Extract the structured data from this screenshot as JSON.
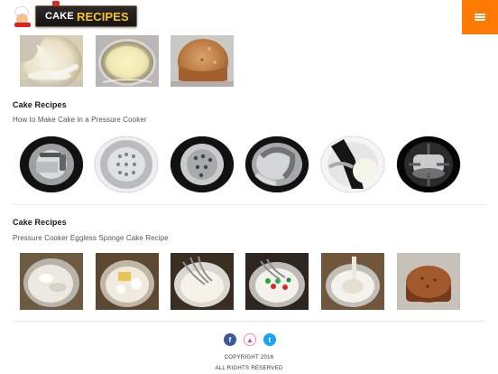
{
  "header": {
    "logo_cake": "CAKE",
    "logo_recipes": "RECIPES"
  },
  "section_one": {
    "image_names": [
      "batter-blending",
      "greased-pan",
      "baked-sponge"
    ]
  },
  "section_two": {
    "title": "Cake Recipes",
    "subtitle": "How to Make Cake in a Pressure Cooker"
  },
  "section_three": {
    "title": "Cake Recipes",
    "subtitle": "Pressure Cooker Eggless Sponge Cake Recipe"
  },
  "footer": {
    "facebook_label": "f",
    "top_label": "▲",
    "twitter_label": "t",
    "copyright_line_1": "COPYRIGHT 2016",
    "copyright_line_2": "ALL RIGHTS RESERVED"
  },
  "colors": {
    "menu_orange": "#ff7a05",
    "facebook_blue": "#3b5998",
    "twitter_blue": "#1da1f2",
    "top_pink": "#e23e72"
  }
}
